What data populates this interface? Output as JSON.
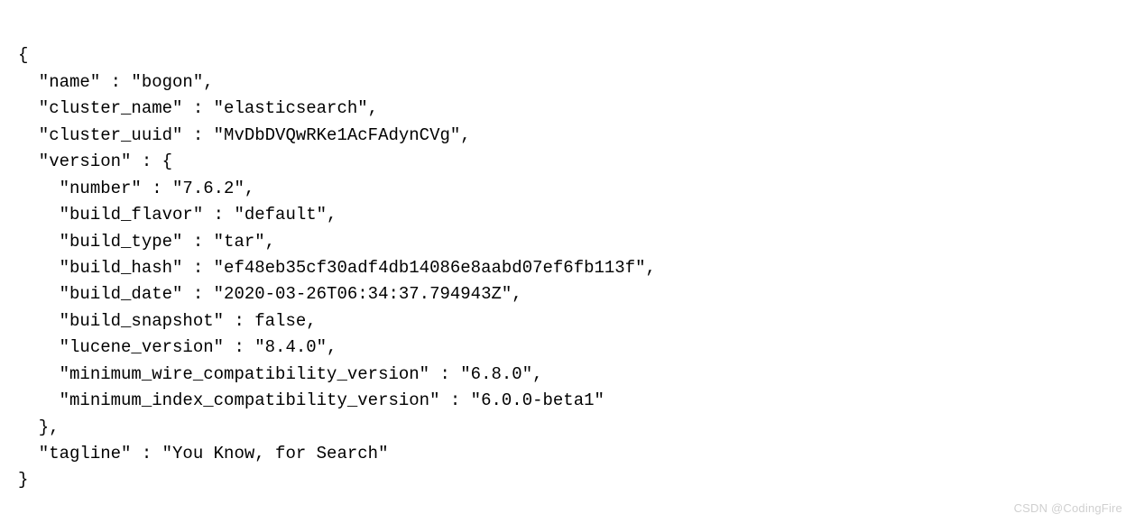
{
  "json_display": {
    "name": "bogon",
    "cluster_name": "elasticsearch",
    "cluster_uuid": "MvDbDVQwRKe1AcFAdynCVg",
    "version": {
      "number": "7.6.2",
      "build_flavor": "default",
      "build_type": "tar",
      "build_hash": "ef48eb35cf30adf4db14086e8aabd07ef6fb113f",
      "build_date": "2020-03-26T06:34:37.794943Z",
      "build_snapshot": "false",
      "lucene_version": "8.4.0",
      "minimum_wire_compatibility_version": "6.8.0",
      "minimum_index_compatibility_version": "6.0.0-beta1"
    },
    "tagline": "You Know, for Search"
  },
  "lines": {
    "l0": "{",
    "l1": "  \"name\" : \"bogon\",",
    "l2": "  \"cluster_name\" : \"elasticsearch\",",
    "l3": "  \"cluster_uuid\" : \"MvDbDVQwRKe1AcFAdynCVg\",",
    "l4": "  \"version\" : {",
    "l5": "    \"number\" : \"7.6.2\",",
    "l6": "    \"build_flavor\" : \"default\",",
    "l7": "    \"build_type\" : \"tar\",",
    "l8": "    \"build_hash\" : \"ef48eb35cf30adf4db14086e8aabd07ef6fb113f\",",
    "l9": "    \"build_date\" : \"2020-03-26T06:34:37.794943Z\",",
    "l10": "    \"build_snapshot\" : false,",
    "l11": "    \"lucene_version\" : \"8.4.0\",",
    "l12": "    \"minimum_wire_compatibility_version\" : \"6.8.0\",",
    "l13": "    \"minimum_index_compatibility_version\" : \"6.0.0-beta1\"",
    "l14": "  },",
    "l15": "  \"tagline\" : \"You Know, for Search\"",
    "l16": "}"
  },
  "watermark": "CSDN @CodingFire"
}
